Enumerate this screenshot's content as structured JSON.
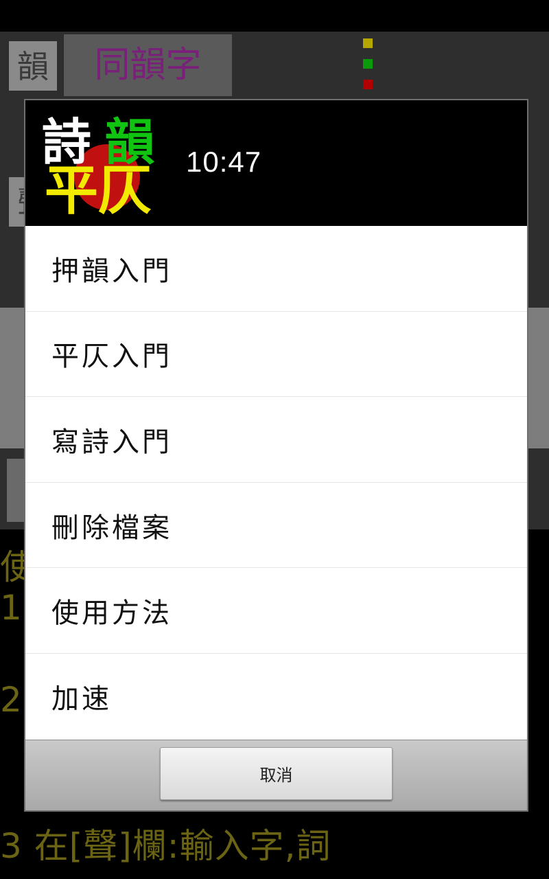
{
  "background": {
    "rhyme_label": "韻",
    "same_rhyme_tab": "同韻字",
    "tone_label": "聲",
    "instructions": [
      {
        "text": "使"
      },
      {
        "text": "1"
      },
      {
        "text": "2"
      },
      {
        "text": "3 在[聲]欄:輸入字,詞"
      }
    ],
    "indicator_colors": [
      "#b3a700",
      "#0a9a0a",
      "#b00000"
    ]
  },
  "dialog": {
    "logo": {
      "top_left": "詩",
      "top_right": "韻",
      "bottom": "平仄"
    },
    "time": "10:47",
    "menu_items": [
      {
        "label": "押韻入門"
      },
      {
        "label": "平仄入門"
      },
      {
        "label": "寫詩入門"
      },
      {
        "label": "刪除檔案"
      },
      {
        "label": "使用方法"
      },
      {
        "label": "加速"
      }
    ],
    "cancel_label": "取消"
  },
  "colors": {
    "logo_white": "#ffffff",
    "logo_green": "#11c411",
    "logo_yellow": "#f2ea00",
    "logo_red_circle": "#c01010",
    "instruction_text": "#6b6414"
  }
}
